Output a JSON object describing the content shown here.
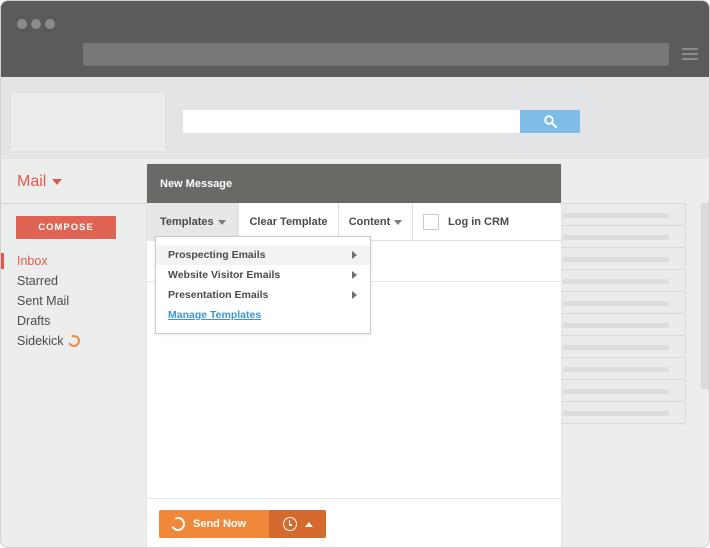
{
  "compose_panel": {
    "title": "New Message",
    "toolbar": {
      "templates_label": "Templates",
      "clear_template_label": "Clear Template",
      "content_label": "Content",
      "log_in_crm_label": "Log in CRM",
      "log_in_crm_checked": false
    },
    "templates_menu": {
      "items": [
        {
          "label": "Prospecting Emails",
          "has_submenu": true
        },
        {
          "label": "Website Visitor Emails",
          "has_submenu": true
        },
        {
          "label": "Presentation Emails",
          "has_submenu": true
        }
      ],
      "manage_label": "Manage Templates"
    },
    "footer": {
      "send_label": "Send Now"
    }
  },
  "sidebar": {
    "mail_label": "Mail",
    "compose_label": "COMPOSE",
    "items": [
      {
        "label": "Inbox",
        "active": true
      },
      {
        "label": "Starred"
      },
      {
        "label": "Sent Mail"
      },
      {
        "label": "Drafts"
      },
      {
        "label": "Sidekick",
        "icon": "sidekick-icon"
      }
    ]
  },
  "colors": {
    "accent_red": "#e05a49",
    "send_orange": "#f0883a",
    "schedule_orange": "#d46a2d",
    "link_blue": "#3b97d3",
    "search_blue": "#7fbde6"
  }
}
